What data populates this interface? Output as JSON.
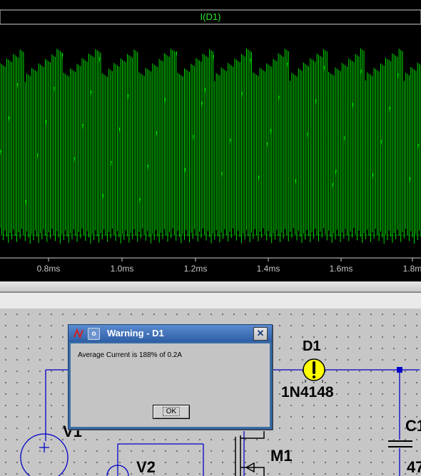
{
  "waveform": {
    "trace_name": "I(D1)",
    "x_ticks": [
      "0.8ms",
      "1.0ms",
      "1.2ms",
      "1.4ms",
      "1.6ms",
      "1.8m"
    ],
    "trace_color": "#00e000"
  },
  "schematic": {
    "diode_ref": "D1",
    "diode_part": "1N4148",
    "source_v1": "V1",
    "source_v2": "V2",
    "mosfet_ref": "M1",
    "cap_ref": "C1",
    "cap_value_partial": "47",
    "diode_warning_glyph": "!"
  },
  "dialog": {
    "title": "Warning - D1",
    "sys_icon": "o",
    "close_glyph": "✕",
    "message": "Average Current is 188% of 0.2A",
    "ok_label": "OK"
  },
  "colors": {
    "wire": "#0000c8",
    "waveform_bg": "#000000",
    "dialog_title": "#2e5ea6"
  }
}
